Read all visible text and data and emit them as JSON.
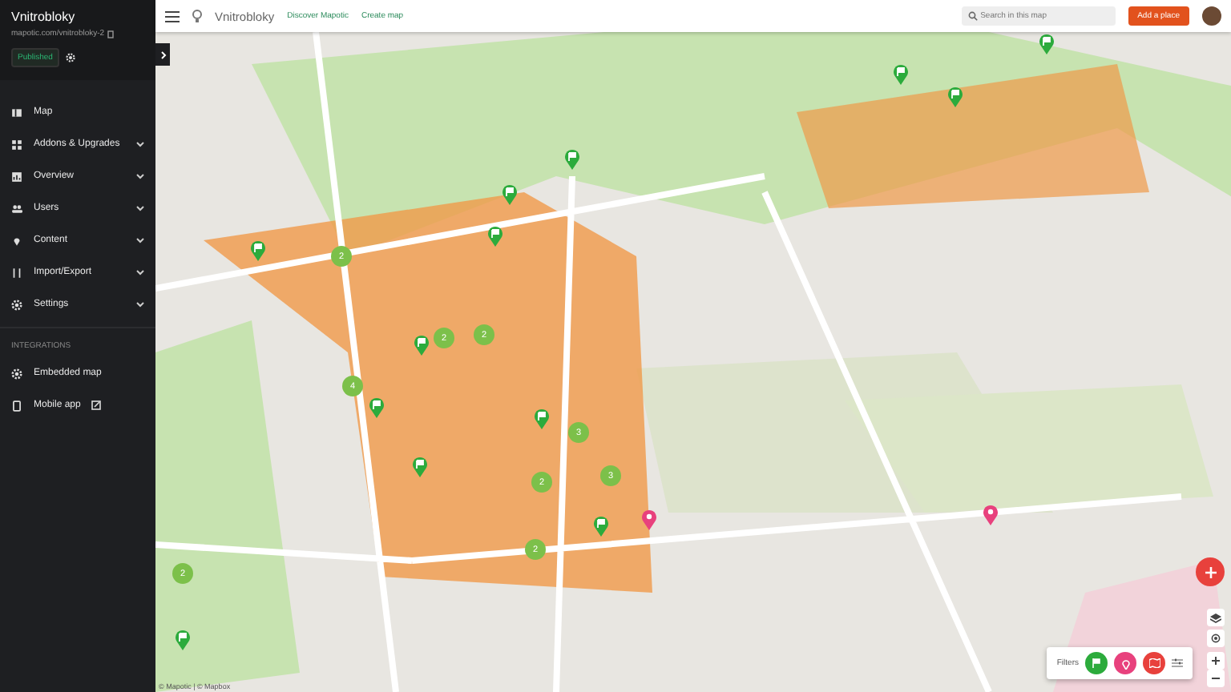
{
  "sidebar": {
    "title": "Vnitrobloky",
    "url": "mapotic.com/vnitrobloky-2",
    "status": "Published",
    "items": [
      {
        "label": "Map",
        "expandable": false
      },
      {
        "label": "Addons & Upgrades",
        "expandable": true
      },
      {
        "label": "Overview",
        "expandable": true
      },
      {
        "label": "Users",
        "expandable": true
      },
      {
        "label": "Content",
        "expandable": true
      },
      {
        "label": "Import/Export",
        "expandable": true
      },
      {
        "label": "Settings",
        "expandable": true
      }
    ],
    "section": "INTEGRATIONS",
    "integrations": [
      {
        "label": "Embedded map",
        "external": false
      },
      {
        "label": "Mobile app",
        "external": true
      }
    ]
  },
  "header": {
    "map_name": "Vnitrobloky",
    "links": [
      "Discover Mapotic",
      "Create map"
    ],
    "search": {
      "placeholder": "Search in this map"
    },
    "add_button": "Add a place"
  },
  "map": {
    "markers": [
      {
        "kind": "cluster",
        "label": "2"
      },
      {
        "kind": "cluster",
        "label": "2"
      },
      {
        "kind": "cluster",
        "label": "2"
      },
      {
        "kind": "cluster",
        "label": "4"
      },
      {
        "kind": "cluster",
        "label": "3"
      },
      {
        "kind": "cluster",
        "label": "3"
      },
      {
        "kind": "cluster",
        "label": "2"
      },
      {
        "kind": "cluster",
        "label": "2"
      },
      {
        "kind": "cluster",
        "label": "2"
      },
      {
        "kind": "flag"
      },
      {
        "kind": "flag"
      },
      {
        "kind": "flag"
      },
      {
        "kind": "flag"
      },
      {
        "kind": "flag"
      },
      {
        "kind": "flag"
      },
      {
        "kind": "flag"
      },
      {
        "kind": "flag"
      },
      {
        "kind": "flag"
      },
      {
        "kind": "flag"
      },
      {
        "kind": "flag"
      },
      {
        "kind": "flag"
      },
      {
        "kind": "flag"
      },
      {
        "kind": "place"
      },
      {
        "kind": "place"
      }
    ],
    "filters_label": "Filters",
    "attribution": "© Mapotic | © Mapbox"
  }
}
